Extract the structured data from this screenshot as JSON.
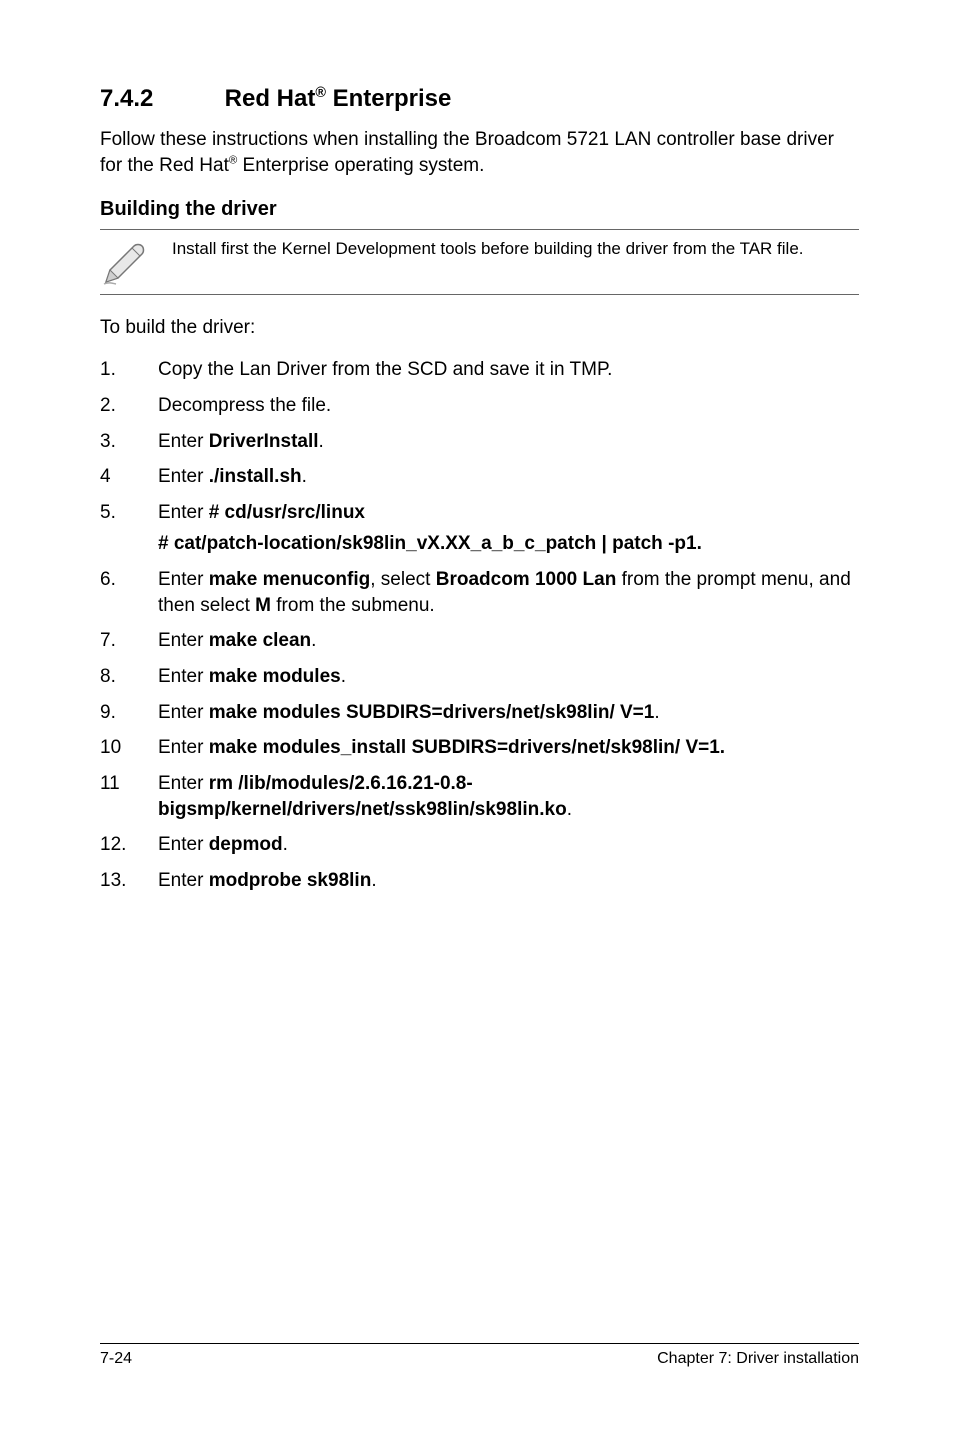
{
  "section": {
    "number": "7.4.2",
    "title_pre": "Red Hat",
    "title_sup": "®",
    "title_post": " Enterprise"
  },
  "intro": {
    "line1": "Follow these instructions when installing the Broadcom 5721 LAN controller base driver for the Red Hat",
    "sup": "®",
    "line2": " Enterprise operating system."
  },
  "subheading": "Building the driver",
  "note": "Install first the Kernel Development tools before building the driver from the TAR file.",
  "lead": "To build the driver:",
  "steps": [
    {
      "n": "1.",
      "body": [
        {
          "t": "Copy the Lan Driver from the SCD and save it in TMP."
        }
      ]
    },
    {
      "n": "2.",
      "body": [
        {
          "t": "Decompress the file."
        }
      ]
    },
    {
      "n": "3.",
      "body": [
        {
          "t": "Enter "
        },
        {
          "b": "DriverInstall"
        },
        {
          "t": "."
        }
      ]
    },
    {
      "n": "4",
      "body": [
        {
          "t": "Enter "
        },
        {
          "b": "./install.sh"
        },
        {
          "t": "."
        }
      ]
    },
    {
      "n": "5.",
      "body": [
        {
          "t": "Enter "
        },
        {
          "b": "# cd/usr/src/linux"
        }
      ],
      "sub": [
        {
          "b": "# cat/patch-location/sk98lin_vX.XX_a_b_c_patch | patch -p1."
        }
      ]
    },
    {
      "n": "6.",
      "body": [
        {
          "t": "Enter "
        },
        {
          "b": "make menuconfig"
        },
        {
          "t": ", select "
        },
        {
          "b": "Broadcom 1000 Lan"
        },
        {
          "t": " from the prompt menu, and then select "
        },
        {
          "b": "M"
        },
        {
          "t": " from the submenu."
        }
      ]
    },
    {
      "n": "7.",
      "body": [
        {
          "t": "Enter "
        },
        {
          "b": "make clean"
        },
        {
          "t": "."
        }
      ]
    },
    {
      "n": "8.",
      "body": [
        {
          "t": "Enter "
        },
        {
          "b": "make modules"
        },
        {
          "t": "."
        }
      ]
    },
    {
      "n": "9.",
      "body": [
        {
          "t": "Enter "
        },
        {
          "b": "make modules SUBDIRS=drivers/net/sk98lin/ V=1"
        },
        {
          "t": "."
        }
      ]
    },
    {
      "n": "10",
      "body": [
        {
          "t": "Enter "
        },
        {
          "b": "make modules_install SUBDIRS=drivers/net/sk98lin/ V=1."
        }
      ]
    },
    {
      "n": "11",
      "body": [
        {
          "t": "Enter "
        },
        {
          "b": "rm /lib/modules/2.6.16.21-0.8-bigsmp/kernel/drivers/net/ssk98lin/sk98lin.ko"
        },
        {
          "t": "."
        }
      ]
    },
    {
      "n": "12.",
      "body": [
        {
          "t": "Enter "
        },
        {
          "b": "depmod"
        },
        {
          "t": "."
        }
      ]
    },
    {
      "n": "13.",
      "body": [
        {
          "t": "Enter "
        },
        {
          "b": "modprobe sk98lin"
        },
        {
          "t": "."
        }
      ]
    }
  ],
  "footer": {
    "left": "7-24",
    "right": "Chapter 7: Driver installation"
  }
}
